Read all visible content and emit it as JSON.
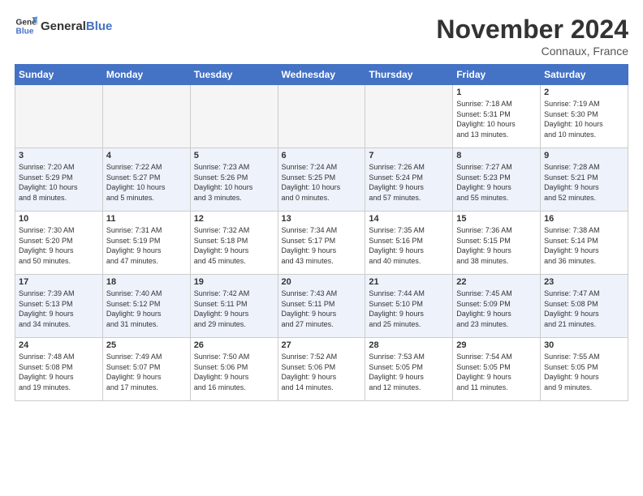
{
  "header": {
    "logo_general": "General",
    "logo_blue": "Blue",
    "month": "November 2024",
    "location": "Connaux, France"
  },
  "weekdays": [
    "Sunday",
    "Monday",
    "Tuesday",
    "Wednesday",
    "Thursday",
    "Friday",
    "Saturday"
  ],
  "weeks": [
    [
      {
        "day": "",
        "info": ""
      },
      {
        "day": "",
        "info": ""
      },
      {
        "day": "",
        "info": ""
      },
      {
        "day": "",
        "info": ""
      },
      {
        "day": "",
        "info": ""
      },
      {
        "day": "1",
        "info": "Sunrise: 7:18 AM\nSunset: 5:31 PM\nDaylight: 10 hours\nand 13 minutes."
      },
      {
        "day": "2",
        "info": "Sunrise: 7:19 AM\nSunset: 5:30 PM\nDaylight: 10 hours\nand 10 minutes."
      }
    ],
    [
      {
        "day": "3",
        "info": "Sunrise: 7:20 AM\nSunset: 5:29 PM\nDaylight: 10 hours\nand 8 minutes."
      },
      {
        "day": "4",
        "info": "Sunrise: 7:22 AM\nSunset: 5:27 PM\nDaylight: 10 hours\nand 5 minutes."
      },
      {
        "day": "5",
        "info": "Sunrise: 7:23 AM\nSunset: 5:26 PM\nDaylight: 10 hours\nand 3 minutes."
      },
      {
        "day": "6",
        "info": "Sunrise: 7:24 AM\nSunset: 5:25 PM\nDaylight: 10 hours\nand 0 minutes."
      },
      {
        "day": "7",
        "info": "Sunrise: 7:26 AM\nSunset: 5:24 PM\nDaylight: 9 hours\nand 57 minutes."
      },
      {
        "day": "8",
        "info": "Sunrise: 7:27 AM\nSunset: 5:23 PM\nDaylight: 9 hours\nand 55 minutes."
      },
      {
        "day": "9",
        "info": "Sunrise: 7:28 AM\nSunset: 5:21 PM\nDaylight: 9 hours\nand 52 minutes."
      }
    ],
    [
      {
        "day": "10",
        "info": "Sunrise: 7:30 AM\nSunset: 5:20 PM\nDaylight: 9 hours\nand 50 minutes."
      },
      {
        "day": "11",
        "info": "Sunrise: 7:31 AM\nSunset: 5:19 PM\nDaylight: 9 hours\nand 47 minutes."
      },
      {
        "day": "12",
        "info": "Sunrise: 7:32 AM\nSunset: 5:18 PM\nDaylight: 9 hours\nand 45 minutes."
      },
      {
        "day": "13",
        "info": "Sunrise: 7:34 AM\nSunset: 5:17 PM\nDaylight: 9 hours\nand 43 minutes."
      },
      {
        "day": "14",
        "info": "Sunrise: 7:35 AM\nSunset: 5:16 PM\nDaylight: 9 hours\nand 40 minutes."
      },
      {
        "day": "15",
        "info": "Sunrise: 7:36 AM\nSunset: 5:15 PM\nDaylight: 9 hours\nand 38 minutes."
      },
      {
        "day": "16",
        "info": "Sunrise: 7:38 AM\nSunset: 5:14 PM\nDaylight: 9 hours\nand 36 minutes."
      }
    ],
    [
      {
        "day": "17",
        "info": "Sunrise: 7:39 AM\nSunset: 5:13 PM\nDaylight: 9 hours\nand 34 minutes."
      },
      {
        "day": "18",
        "info": "Sunrise: 7:40 AM\nSunset: 5:12 PM\nDaylight: 9 hours\nand 31 minutes."
      },
      {
        "day": "19",
        "info": "Sunrise: 7:42 AM\nSunset: 5:11 PM\nDaylight: 9 hours\nand 29 minutes."
      },
      {
        "day": "20",
        "info": "Sunrise: 7:43 AM\nSunset: 5:11 PM\nDaylight: 9 hours\nand 27 minutes."
      },
      {
        "day": "21",
        "info": "Sunrise: 7:44 AM\nSunset: 5:10 PM\nDaylight: 9 hours\nand 25 minutes."
      },
      {
        "day": "22",
        "info": "Sunrise: 7:45 AM\nSunset: 5:09 PM\nDaylight: 9 hours\nand 23 minutes."
      },
      {
        "day": "23",
        "info": "Sunrise: 7:47 AM\nSunset: 5:08 PM\nDaylight: 9 hours\nand 21 minutes."
      }
    ],
    [
      {
        "day": "24",
        "info": "Sunrise: 7:48 AM\nSunset: 5:08 PM\nDaylight: 9 hours\nand 19 minutes."
      },
      {
        "day": "25",
        "info": "Sunrise: 7:49 AM\nSunset: 5:07 PM\nDaylight: 9 hours\nand 17 minutes."
      },
      {
        "day": "26",
        "info": "Sunrise: 7:50 AM\nSunset: 5:06 PM\nDaylight: 9 hours\nand 16 minutes."
      },
      {
        "day": "27",
        "info": "Sunrise: 7:52 AM\nSunset: 5:06 PM\nDaylight: 9 hours\nand 14 minutes."
      },
      {
        "day": "28",
        "info": "Sunrise: 7:53 AM\nSunset: 5:05 PM\nDaylight: 9 hours\nand 12 minutes."
      },
      {
        "day": "29",
        "info": "Sunrise: 7:54 AM\nSunset: 5:05 PM\nDaylight: 9 hours\nand 11 minutes."
      },
      {
        "day": "30",
        "info": "Sunrise: 7:55 AM\nSunset: 5:05 PM\nDaylight: 9 hours\nand 9 minutes."
      }
    ]
  ]
}
